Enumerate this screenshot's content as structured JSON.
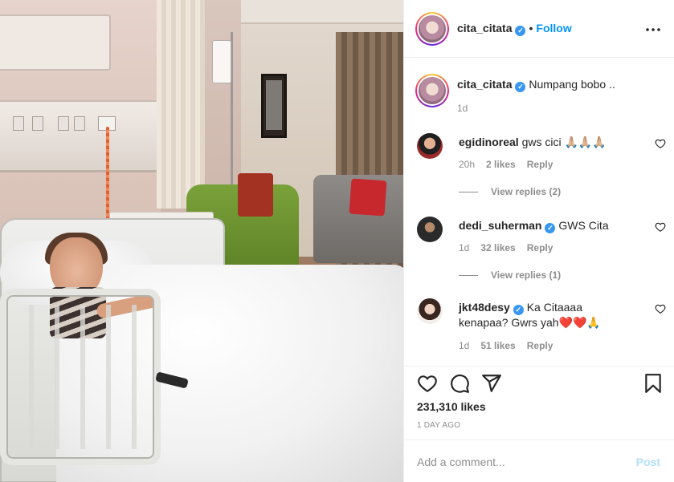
{
  "post": {
    "author": "cita_citata",
    "follow_label": "Follow",
    "separator": "•",
    "caption": "Numpang bobo ..",
    "caption_age": "1d",
    "likes_count": "231,310 likes",
    "posted_time": "1 DAY AGO",
    "verified_glyph": "✓"
  },
  "comments": [
    {
      "username": "egidinoreal",
      "text": "gws cici 🙏🏼🙏🏼🙏🏼",
      "age": "20h",
      "likes": "2 likes",
      "reply_label": "Reply",
      "view_replies": "View replies (2)",
      "verified": false
    },
    {
      "username": "dedi_suherman",
      "text": "GWS Cita",
      "age": "1d",
      "likes": "32 likes",
      "reply_label": "Reply",
      "view_replies": "View replies (1)",
      "verified": true
    },
    {
      "username": "jkt48desy",
      "text": "Ka Citaaaa kenapaa? Gwrs yah❤️❤️🙏",
      "age": "1d",
      "likes": "51 likes",
      "reply_label": "Reply",
      "verified": true
    }
  ],
  "add_comment": {
    "placeholder": "Add a comment...",
    "post_label": "Post"
  },
  "icons": {
    "like": "heart-icon",
    "comment": "comment-icon",
    "share": "paper-plane-icon",
    "save": "bookmark-icon",
    "more": "more-options-icon"
  },
  "colors": {
    "accent": "#0095f6",
    "verified": "#3897f0",
    "muted": "#8e8e8e",
    "post_disabled": "#b2dffc"
  }
}
